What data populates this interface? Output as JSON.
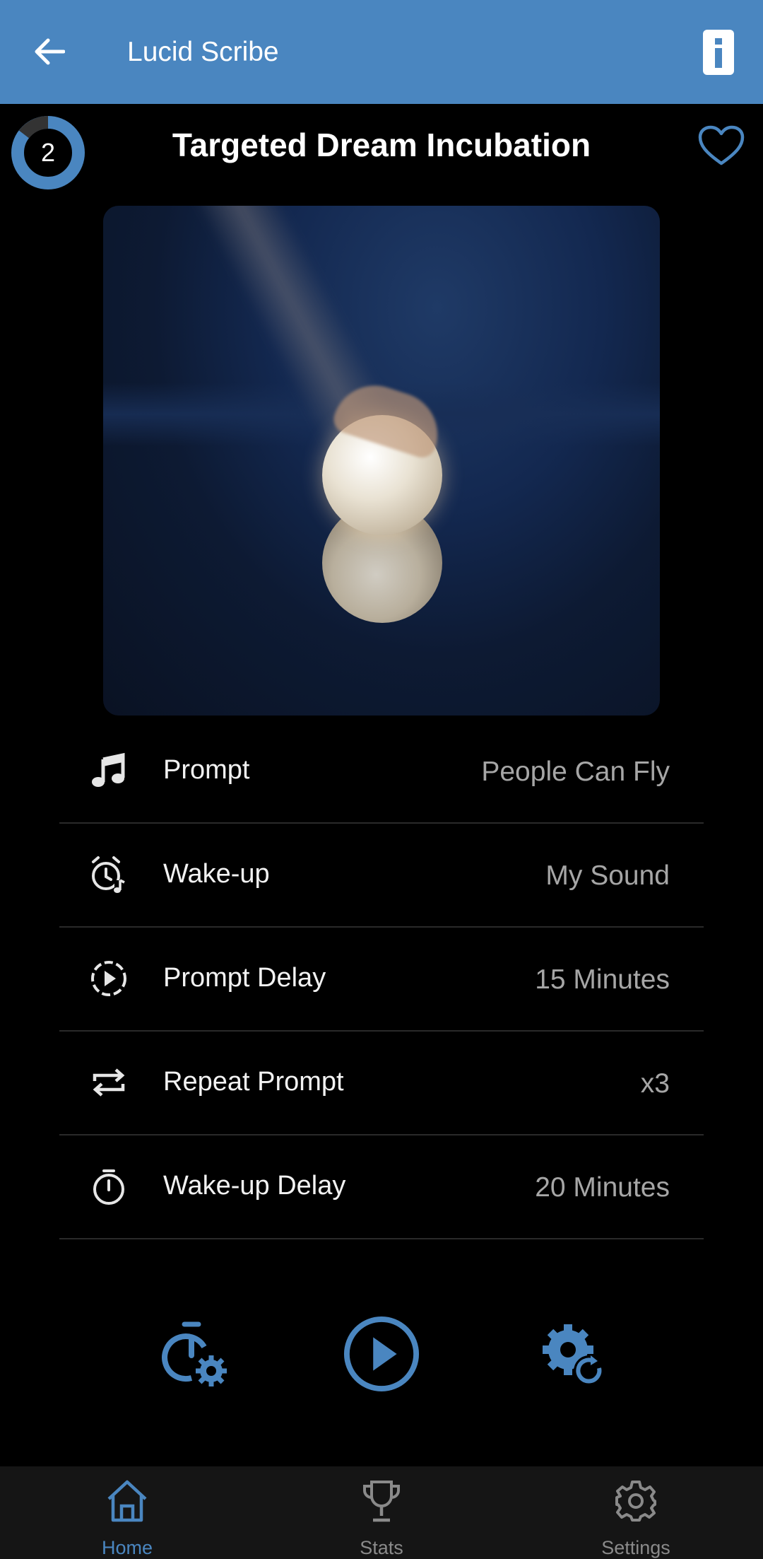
{
  "appbar": {
    "title": "Lucid Scribe"
  },
  "header": {
    "badge_count": "2",
    "title": "Targeted Dream Incubation"
  },
  "settings": [
    {
      "icon": "music-note-icon",
      "label": "Prompt",
      "value": "People Can Fly"
    },
    {
      "icon": "alarm-clock-sound-icon",
      "label": "Wake-up",
      "value": "My Sound"
    },
    {
      "icon": "play-delay-icon",
      "label": "Prompt Delay",
      "value": "15 Minutes"
    },
    {
      "icon": "repeat-icon",
      "label": "Repeat Prompt",
      "value": "x3"
    },
    {
      "icon": "stopwatch-icon",
      "label": "Wake-up Delay",
      "value": "20 Minutes"
    }
  ],
  "actions": [
    {
      "icon": "timer-settings-icon"
    },
    {
      "icon": "play-icon"
    },
    {
      "icon": "gear-refresh-icon"
    }
  ],
  "bottom_nav": [
    {
      "icon": "home-icon",
      "label": "Home",
      "active": true
    },
    {
      "icon": "trophy-icon",
      "label": "Stats",
      "active": false
    },
    {
      "icon": "settings-gear-icon",
      "label": "Settings",
      "active": false
    }
  ],
  "colors": {
    "accent": "#4A86C0",
    "appbar": "#4A86C0",
    "background": "#000000",
    "nav_background": "#151515"
  }
}
